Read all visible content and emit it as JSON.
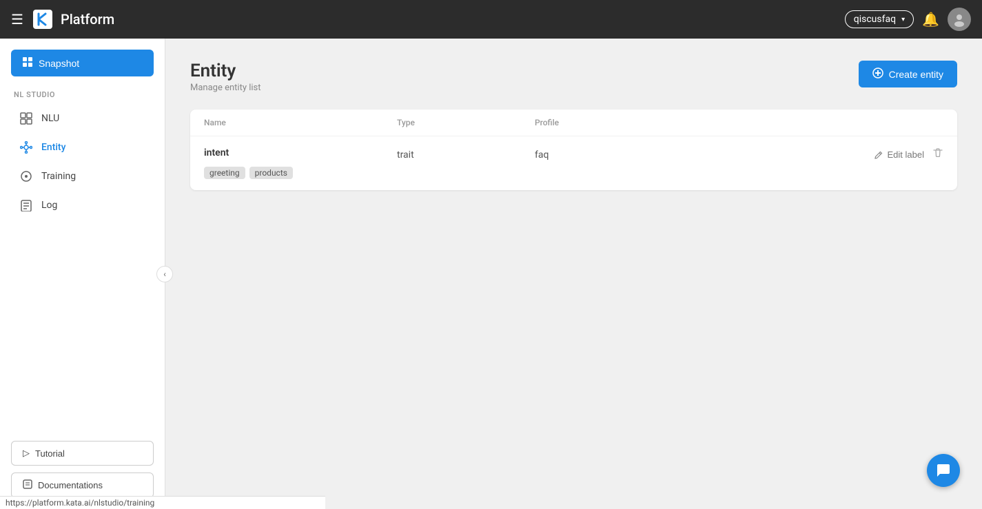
{
  "app": {
    "title": "Platform"
  },
  "topnav": {
    "title": "Platform",
    "account_name": "qiscusfaq",
    "menu_icon": "☰",
    "bell_icon": "🔔",
    "caret_icon": "▾",
    "avatar_icon": "👤"
  },
  "sidebar": {
    "snapshot_label": "Snapshot",
    "snapshot_icon": "▦",
    "section_label": "NL STUDIO",
    "items": [
      {
        "id": "nlu",
        "label": "NLU",
        "icon": "layers"
      },
      {
        "id": "entity",
        "label": "Entity",
        "icon": "entity",
        "active": true
      },
      {
        "id": "training",
        "label": "Training",
        "icon": "training"
      },
      {
        "id": "log",
        "label": "Log",
        "icon": "log"
      }
    ],
    "tutorial_label": "Tutorial",
    "tutorial_icon": "▷",
    "docs_label": "Documentations",
    "docs_icon": "📄"
  },
  "main": {
    "page_title": "Entity",
    "page_subtitle": "Manage entity list",
    "create_button_label": "Create entity",
    "table": {
      "columns": [
        {
          "key": "name",
          "label": "Name"
        },
        {
          "key": "type",
          "label": "Type"
        },
        {
          "key": "profile",
          "label": "Profile"
        }
      ],
      "rows": [
        {
          "name": "intent",
          "type": "trait",
          "profile": "faq",
          "tags": [
            "greeting",
            "products"
          ]
        }
      ]
    },
    "edit_label_text": "Edit label",
    "delete_icon": "🗑"
  },
  "statusbar": {
    "url": "https://platform.kata.ai/nlstudio/training"
  }
}
